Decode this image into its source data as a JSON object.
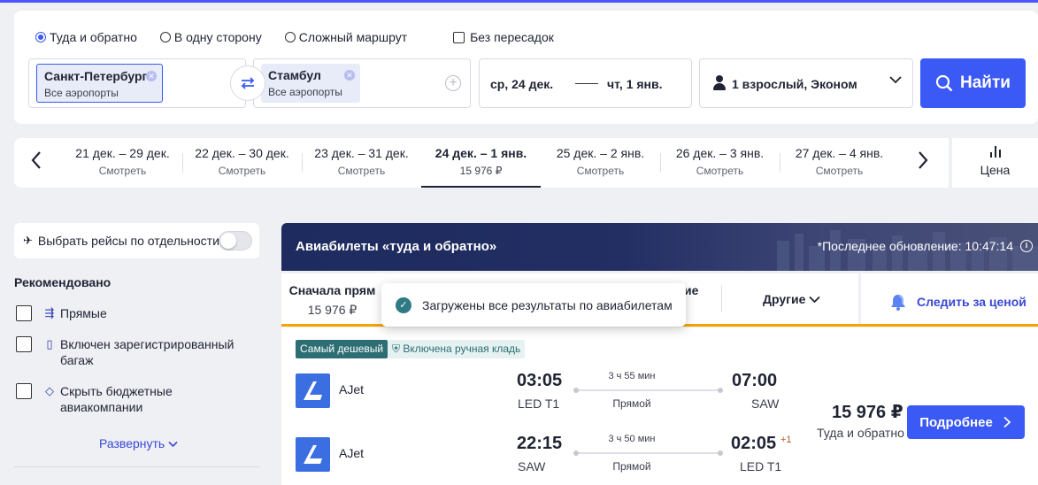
{
  "search": {
    "trip_types": [
      "Туда и обратно",
      "В одну сторону",
      "Сложный маршрут"
    ],
    "active_trip_type": 0,
    "direct_only_label": "Без пересадок",
    "from": {
      "city": "Санкт-Петербург",
      "airports": "Все аэропорты"
    },
    "to": {
      "city": "Стамбул",
      "airports": "Все аэропорты"
    },
    "date_from": "ср, 24 дек.",
    "date_to": "чт, 1 янв.",
    "passengers": "1 взрослый, Эконом",
    "search_label": "Найти"
  },
  "date_strip": {
    "items": [
      {
        "range": "21 дек. – 29 дек.",
        "sub": "Смотреть"
      },
      {
        "range": "22 дек. – 30 дек.",
        "sub": "Смотреть"
      },
      {
        "range": "23 дек. – 31 дек.",
        "sub": "Смотреть"
      },
      {
        "range": "24 дек. – 1 янв.",
        "sub": "15 976 ₽"
      },
      {
        "range": "25 дек. – 2 янв.",
        "sub": "Смотреть"
      },
      {
        "range": "26 дек. – 3 янв.",
        "sub": "Смотреть"
      },
      {
        "range": "27 дек. – 4 янв.",
        "sub": "Смотреть"
      }
    ],
    "active_index": 3,
    "price_label": "Цена"
  },
  "sidebar": {
    "separate_flights_label": "Выбрать рейсы по отдельности",
    "recommended_title": "Рекомендовано",
    "filters": [
      {
        "label": "Прямые",
        "icon": "direct-flight-icon"
      },
      {
        "label": "Включен зарегистрированный багаж",
        "icon": "luggage-icon"
      },
      {
        "label": "Скрыть бюджетные авиакомпании",
        "icon": "tag-icon"
      }
    ],
    "expand_label": "Развернуть"
  },
  "results": {
    "title": "Авиабилеты «туда и обратно»",
    "updated": "*Последнее обновление: 10:47:14",
    "sort": {
      "cheapest_label": "Сначала прям",
      "cheapest_price": "15 976 ₽",
      "partial_label": "ие",
      "other_label": "Другие",
      "watch_label": "Следить за ценой"
    },
    "toast": "Загружены все результаты по авиабилетам",
    "card": {
      "badge_cheapest": "Самый дешевый",
      "badge_bag": "Включена ручная кладь",
      "price": "15 976 ₽",
      "price_sub": "Туда и обратно",
      "details_label": "Подробнее",
      "legs": [
        {
          "airline": "AJet",
          "dep_time": "03:05",
          "dep_airport": "LED T1",
          "duration": "3 ч 55 мин",
          "stops": "Прямой",
          "arr_time": "07:00",
          "arr_airport": "SAW",
          "day_shift": ""
        },
        {
          "airline": "AJet",
          "dep_time": "22:15",
          "dep_airport": "SAW",
          "duration": "3 ч 50 мин",
          "stops": "Прямой",
          "arr_time": "02:05",
          "arr_airport": "LED T1",
          "day_shift": "+1"
        }
      ]
    }
  },
  "colors": {
    "accent": "#3a59f5",
    "teal": "#2c6e73",
    "orange": "#f5a400",
    "banner": "#1d2b5e"
  }
}
